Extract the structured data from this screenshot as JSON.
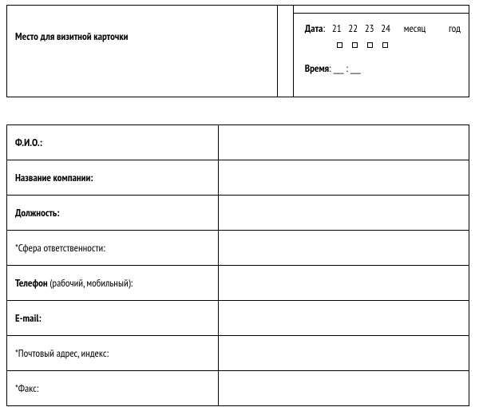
{
  "header": {
    "card_place": "Место для визитной карточки",
    "date_label": "Дата",
    "days": [
      "21",
      "22",
      "23",
      "24"
    ],
    "month_label": "месяц",
    "year_label": "год",
    "time_label": "Время",
    "time_value": "___ : ___"
  },
  "fields": [
    {
      "label_html": "<span class='b'>Ф.И.О.:</span>",
      "value": ""
    },
    {
      "label_html": "<span class='b'>Название компании:</span>",
      "value": ""
    },
    {
      "label_html": "<span class='b'>Должность:</span>",
      "value": ""
    },
    {
      "label_html": "*Сфера ответственности:",
      "value": ""
    },
    {
      "label_html": "<span class='b'>Телефон</span> (рабочий, мобильный):",
      "value": ""
    },
    {
      "label_html": "<span class='b'>E-mail:</span>",
      "value": ""
    },
    {
      "label_html": "*Почтовый адрес, индекс:",
      "value": ""
    },
    {
      "label_html": "*Факс:",
      "value": ""
    }
  ]
}
